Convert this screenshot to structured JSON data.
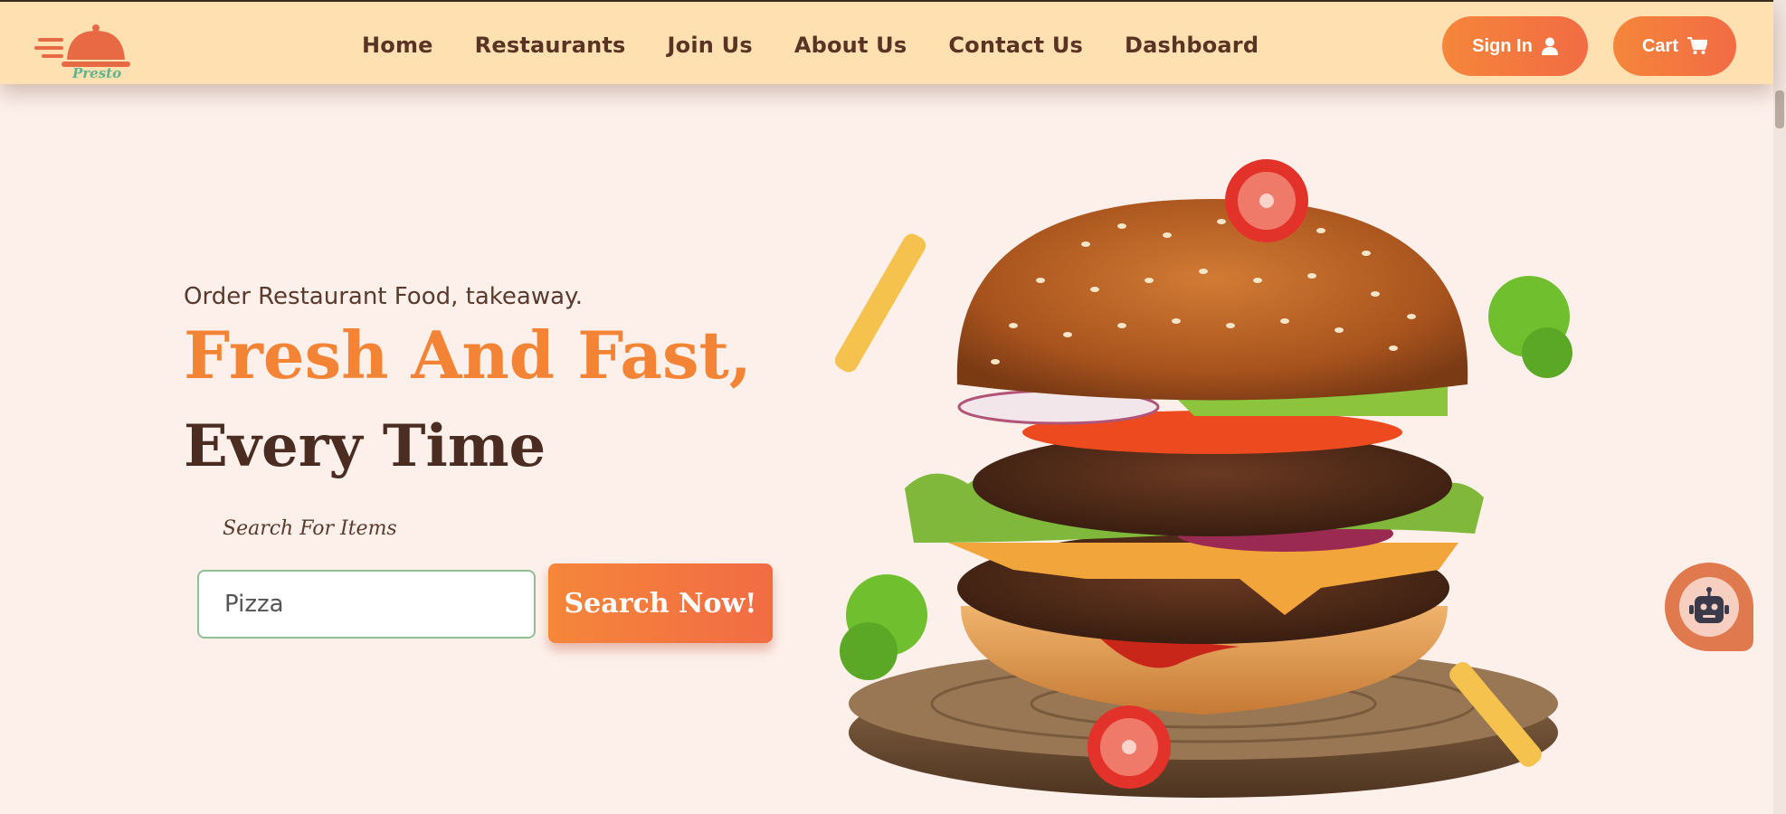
{
  "brand": {
    "name": "Presto",
    "logo_icon": "cloche-icon"
  },
  "nav": {
    "items": [
      {
        "label": "Home"
      },
      {
        "label": "Restaurants"
      },
      {
        "label": "Join Us"
      },
      {
        "label": "About Us"
      },
      {
        "label": "Contact Us"
      },
      {
        "label": "Dashboard"
      }
    ]
  },
  "header_actions": {
    "signin_label": "Sign In",
    "signin_icon": "user-icon",
    "cart_label": "Cart",
    "cart_icon": "cart-icon"
  },
  "hero": {
    "subtitle": "Order Restaurant Food, takeaway.",
    "headline_1": "Fresh And Fast,",
    "headline_2": "Every Time",
    "search_label": "Search For Items",
    "search_value": "Pizza",
    "search_button": "Search Now!",
    "image": "burger-illustration"
  },
  "chatbot": {
    "icon": "robot-icon"
  },
  "colors": {
    "header_bg": "#ffe0b0",
    "page_bg": "#fdf0eb",
    "accent": "#f5863a",
    "accent_end": "#f26b44",
    "nav_text": "#5a3325",
    "headline_dark": "#4a2c20",
    "input_border": "#8fbf95",
    "brand_green": "#5fb38f"
  }
}
